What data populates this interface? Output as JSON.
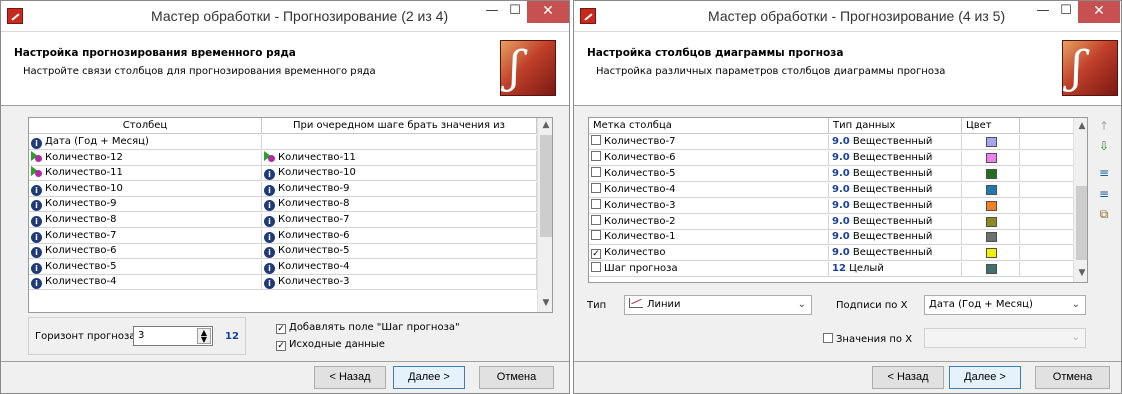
{
  "window1": {
    "title": "Мастер обработки - Прогнозирование (2 из 4)",
    "controls": {
      "minimize": "—",
      "maximize": "☐",
      "close": "✕"
    },
    "header_title": "Настройка прогнозирования временного ряда",
    "header_subtitle": "Настройте связи столбцов для прогнозирования временного ряда",
    "logo_glyph": "ʃ",
    "columns": [
      "Столбец",
      "При очередном шаге брать значения из"
    ],
    "rows": [
      {
        "col": "Дата (Год + Месяц)",
        "col_icon": "info",
        "src": "",
        "src_icon": ""
      },
      {
        "col": "Количество-12",
        "col_icon": "seq",
        "src": "Количество-11",
        "src_icon": "seq"
      },
      {
        "col": "Количество-11",
        "col_icon": "seq",
        "src": "Количество-10",
        "src_icon": "info"
      },
      {
        "col": "Количество-10",
        "col_icon": "info",
        "src": "Количество-9",
        "src_icon": "info"
      },
      {
        "col": "Количество-9",
        "col_icon": "info",
        "src": "Количество-8",
        "src_icon": "info"
      },
      {
        "col": "Количество-8",
        "col_icon": "info",
        "src": "Количество-7",
        "src_icon": "info"
      },
      {
        "col": "Количество-7",
        "col_icon": "info",
        "src": "Количество-6",
        "src_icon": "info"
      },
      {
        "col": "Количество-6",
        "col_icon": "info",
        "src": "Количество-5",
        "src_icon": "info"
      },
      {
        "col": "Количество-5",
        "col_icon": "info",
        "src": "Количество-4",
        "src_icon": "info"
      },
      {
        "col": "Количество-4",
        "col_icon": "info",
        "src": "Количество-3",
        "src_icon": "info"
      }
    ],
    "horizon_label": "Горизонт прогноза",
    "horizon_value": "3",
    "horizon_max": "12",
    "check_step_label": "Добавлять поле \"Шаг прогноза\"",
    "check_step_checked": true,
    "check_source_label": "Исходные данные",
    "check_source_checked": true,
    "back_label": "< Назад",
    "next_label": "Далее >",
    "cancel_label": "Отмена"
  },
  "window2": {
    "title": "Мастер обработки - Прогнозирование (4 из 5)",
    "controls": {
      "minimize": "—",
      "maximize": "☐",
      "close": "✕"
    },
    "header_title": "Настройка столбцов диаграммы прогноза",
    "header_subtitle": "Настройка различных параметров столбцов диаграммы прогноза",
    "logo_glyph": "ʃ",
    "columns": [
      "Метка столбца",
      "Тип данных",
      "Цвет"
    ],
    "rows": [
      {
        "label": "Количество-7",
        "checked": false,
        "type_code": "9.0",
        "type_name": "Вещественный",
        "color": "#a6a6f0"
      },
      {
        "label": "Количество-6",
        "checked": false,
        "type_code": "9.0",
        "type_name": "Вещественный",
        "color": "#f080f0"
      },
      {
        "label": "Количество-5",
        "checked": false,
        "type_code": "9.0",
        "type_name": "Вещественный",
        "color": "#207020"
      },
      {
        "label": "Количество-4",
        "checked": false,
        "type_code": "9.0",
        "type_name": "Вещественный",
        "color": "#1f7ab0"
      },
      {
        "label": "Количество-3",
        "checked": false,
        "type_code": "9.0",
        "type_name": "Вещественный",
        "color": "#f08020"
      },
      {
        "label": "Количество-2",
        "checked": false,
        "type_code": "9.0",
        "type_name": "Вещественный",
        "color": "#8a8a20"
      },
      {
        "label": "Количество-1",
        "checked": false,
        "type_code": "9.0",
        "type_name": "Вещественный",
        "color": "#707070"
      },
      {
        "label": "Количество",
        "checked": true,
        "type_code": "9.0",
        "type_name": "Вещественный",
        "color": "#f0f000"
      },
      {
        "label": "Шаг прогноза",
        "checked": false,
        "type_code": "12",
        "type_name": "Целый",
        "color": "#407070"
      }
    ],
    "side_icons": [
      "↑",
      "⇩",
      "≡",
      "≡",
      "⧉"
    ],
    "type_label": "Тип",
    "type_value": "Линии",
    "xlabels_label": "Подписи по X",
    "xlabels_value": "Дата (Год + Месяц)",
    "xvalues_label": "Значения по X",
    "xvalues_checked": false,
    "back_label": "< Назад",
    "next_label": "Далее >",
    "cancel_label": "Отмена"
  }
}
